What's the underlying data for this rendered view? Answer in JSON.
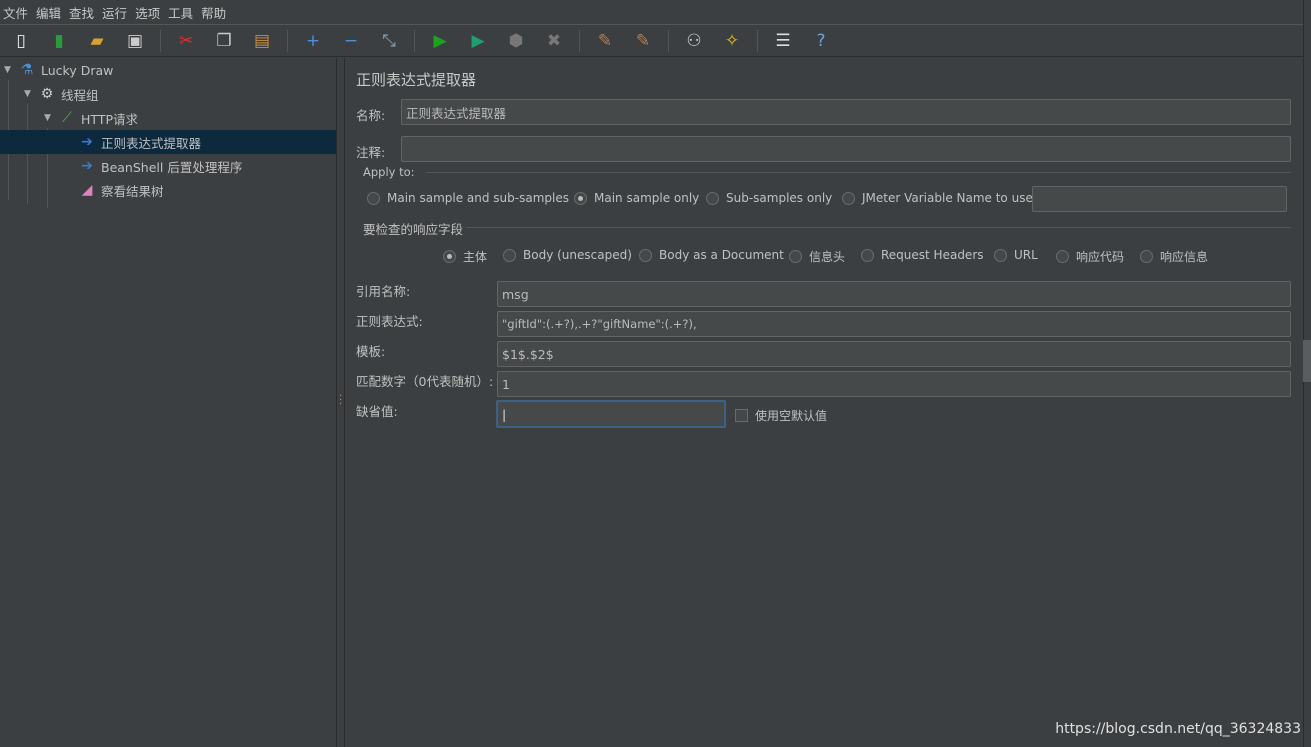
{
  "menu": [
    "文件",
    "编辑",
    "查找",
    "运行",
    "选项",
    "工具",
    "帮助"
  ],
  "toolbar": [
    {
      "icon": "new-icon",
      "g": "▯",
      "c": "#eee"
    },
    {
      "icon": "templates-icon",
      "g": "▮",
      "c": "#2a9a3a"
    },
    {
      "icon": "open-icon",
      "g": "▰",
      "c": "#d9a030"
    },
    {
      "icon": "save-icon",
      "g": "▣",
      "c": "#ccc"
    },
    "sep",
    {
      "icon": "cut-icon",
      "g": "✂",
      "c": "#e03030"
    },
    {
      "icon": "copy-icon",
      "g": "❐",
      "c": "#ccc"
    },
    {
      "icon": "paste-icon",
      "g": "▤",
      "c": "#c89040"
    },
    "sep",
    {
      "icon": "expand-icon",
      "g": "+",
      "c": "#4a90d9"
    },
    {
      "icon": "collapse-icon",
      "g": "−",
      "c": "#4a90d9"
    },
    {
      "icon": "toggle-icon",
      "g": "⤡",
      "c": "#8ab"
    },
    "sep",
    {
      "icon": "start-icon",
      "g": "▶",
      "c": "#1fa31f"
    },
    {
      "icon": "start-no-pause-icon",
      "g": "▶",
      "c": "#1f9f6f"
    },
    {
      "icon": "stop-icon",
      "g": "⬢",
      "c": "#777"
    },
    {
      "icon": "shutdown-icon",
      "g": "✖",
      "c": "#777"
    },
    "sep",
    {
      "icon": "clear-icon",
      "g": "✎",
      "c": "#b08050"
    },
    {
      "icon": "clear-all-icon",
      "g": "✎",
      "c": "#b08050"
    },
    "sep",
    {
      "icon": "search-icon",
      "g": "⚇",
      "c": "#ccc"
    },
    {
      "icon": "reset-search-icon",
      "g": "✧",
      "c": "#f0c020"
    },
    "sep",
    {
      "icon": "function-helper-icon",
      "g": "☰",
      "c": "#ddd"
    },
    {
      "icon": "help-icon",
      "g": "?",
      "c": "#6aa0e0"
    }
  ],
  "tree": [
    {
      "label": "Lucky Draw",
      "icon": "test-plan-icon",
      "g": "⚗",
      "c": "#4a90d9",
      "level": 0,
      "arrow": true
    },
    {
      "label": "线程组",
      "icon": "gear-icon",
      "g": "⚙",
      "c": "#ccc",
      "level": 1,
      "arrow": true
    },
    {
      "label": "HTTP请求",
      "icon": "pipette-icon",
      "g": "⟋",
      "c": "#5ab040",
      "level": 2,
      "arrow": true
    },
    {
      "label": "正则表达式提取器",
      "icon": "post-processor-icon",
      "g": "➔",
      "c": "#3a7ad0",
      "level": 3,
      "selected": true
    },
    {
      "label": "BeanShell 后置处理程序",
      "icon": "post-processor-icon",
      "g": "➔",
      "c": "#3a7ad0",
      "level": 3
    },
    {
      "label": "察看结果树",
      "icon": "listener-icon",
      "g": "◢",
      "c": "#e080c0",
      "level": 3
    }
  ],
  "panel": {
    "title": "正则表达式提取器",
    "name_label": "名称:",
    "name_value": "正则表达式提取器",
    "comment_label": "注释:",
    "comment_value": "",
    "apply_to": "Apply to:",
    "apply_options": [
      "Main sample and sub-samples",
      "Main sample only",
      "Sub-samples only",
      "JMeter Variable Name to use"
    ],
    "apply_selected": 1,
    "jmeter_var_value": "",
    "field_check": "要检查的响应字段",
    "field_options": [
      "主体",
      "Body (unescaped)",
      "Body as a Document",
      "信息头",
      "Request Headers",
      "URL",
      "响应代码",
      "响应信息"
    ],
    "field_selected": 0,
    "ref_label": "引用名称:",
    "ref_value": "msg",
    "regex_label": "正则表达式:",
    "regex_value": "\"giftId\":(.+?),.+?\"giftName\":(.+?),",
    "template_label": "模板:",
    "template_value": "$1$.$2$",
    "match_label": "匹配数字（0代表随机）:",
    "match_value": "1",
    "default_label": "缺省值:",
    "default_value": "",
    "use_empty_label": "使用空默认值",
    "use_empty_checked": false
  },
  "watermark": "https://blog.csdn.net/qq_36324833"
}
